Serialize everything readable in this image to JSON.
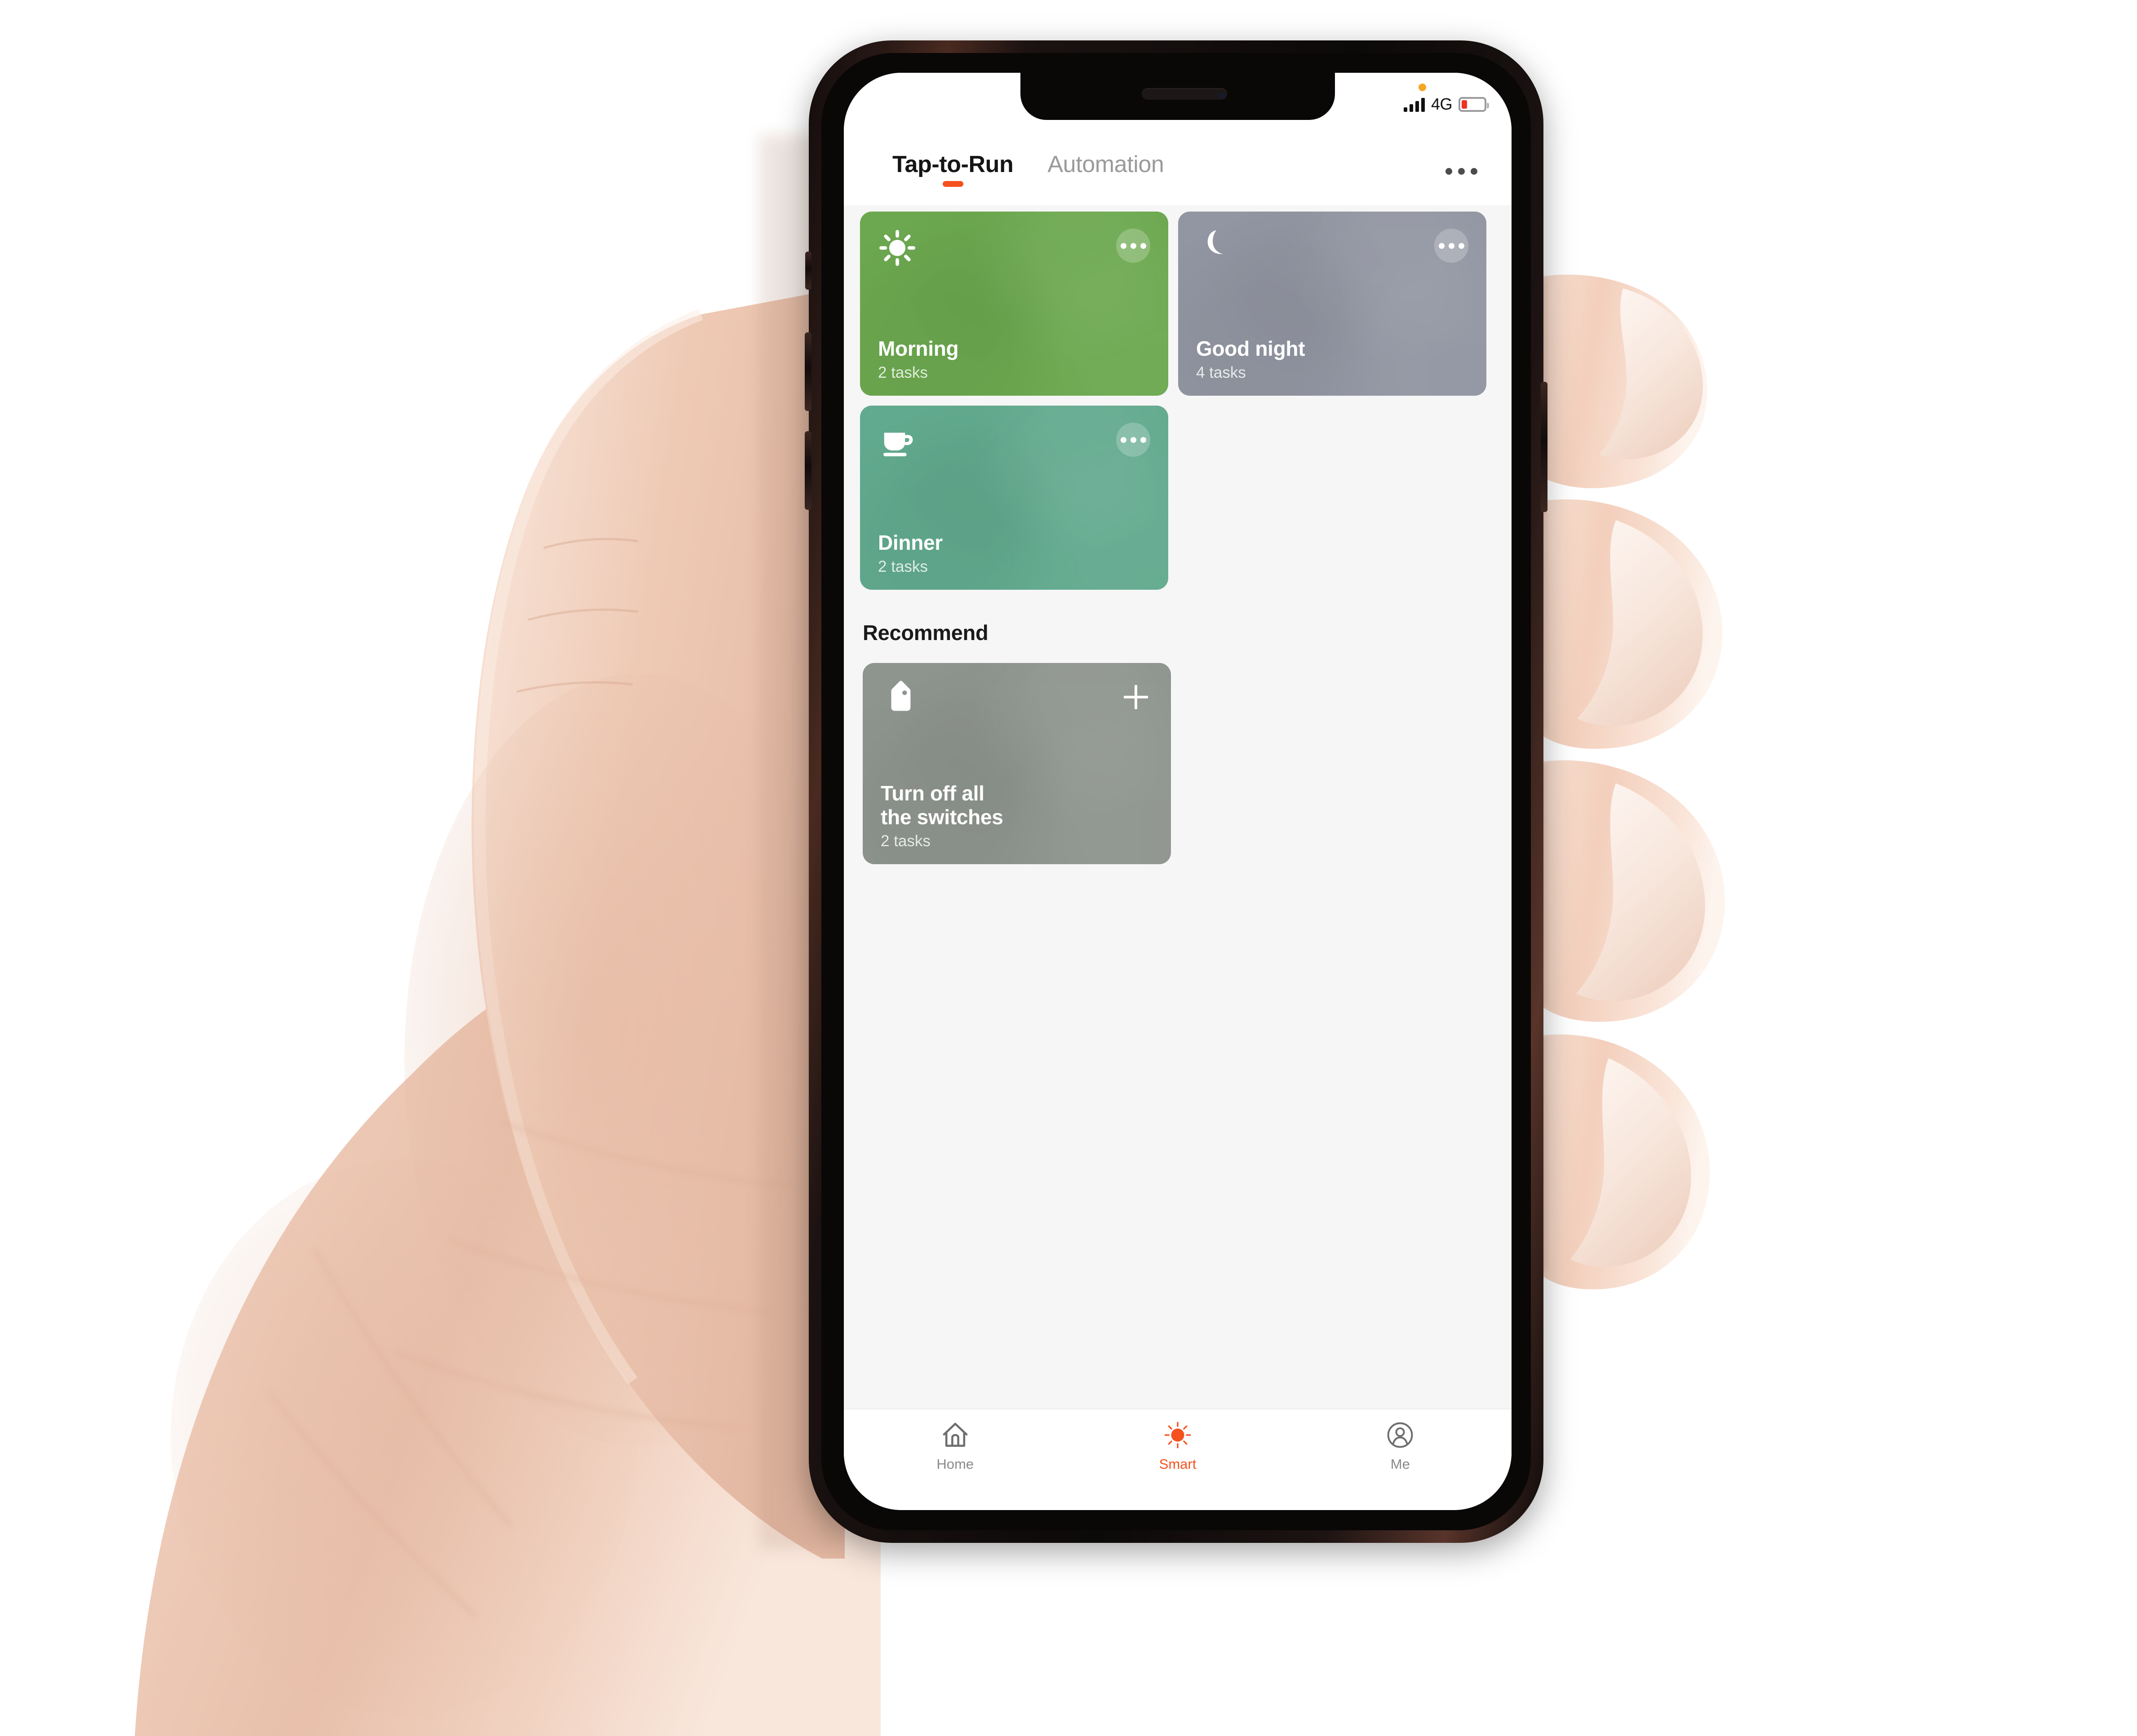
{
  "status_bar": {
    "network": "4G",
    "signal_strength": 4,
    "battery_percent": 20,
    "battery_low": true,
    "recording_indicator": true
  },
  "header": {
    "tabs": [
      {
        "label": "Tap-to-Run",
        "active": true
      },
      {
        "label": "Automation",
        "active": false
      }
    ],
    "more_menu": "more-options"
  },
  "scenes": [
    {
      "title": "Morning",
      "tasks_label": "2 tasks",
      "icon": "sun-icon",
      "color": "#6CA84F",
      "action": "more-options"
    },
    {
      "title": "Good night",
      "tasks_label": "4 tasks",
      "icon": "moon-icon",
      "color": "#9296A2",
      "action": "more-options"
    },
    {
      "title": "Dinner",
      "tasks_label": "2 tasks",
      "icon": "cup-icon",
      "color": "#62AA8F",
      "action": "more-options"
    }
  ],
  "recommend": {
    "section_title": "Recommend",
    "cards": [
      {
        "title": "Turn off all\nthe switches",
        "tasks_label": "2 tasks",
        "icon": "tag-icon",
        "color": "#8E948E",
        "action": "add"
      }
    ]
  },
  "tab_bar": {
    "items": [
      {
        "label": "Home",
        "icon": "house-icon",
        "active": false
      },
      {
        "label": "Smart",
        "icon": "sun-icon",
        "active": true
      },
      {
        "label": "Me",
        "icon": "person-icon",
        "active": false
      }
    ]
  },
  "colors": {
    "accent": "#F4511E",
    "screen_background": "#F6F6F6",
    "battery_low": "#EE3124"
  }
}
